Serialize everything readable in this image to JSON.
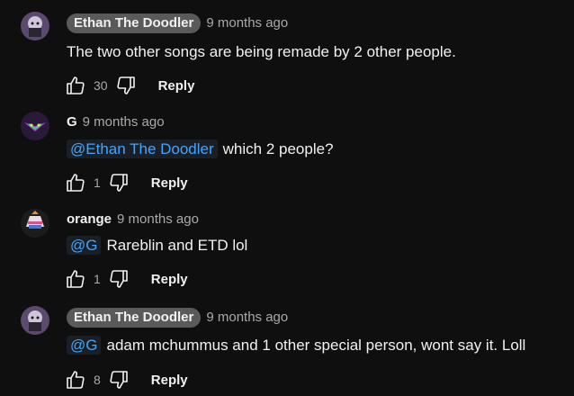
{
  "comments": [
    {
      "author": "Ethan The Doodler",
      "author_style": "pill",
      "time": "9 months ago",
      "mention": "",
      "text": "The two other songs are being remade by 2 other people.",
      "likes": "30",
      "reply_label": "Reply"
    },
    {
      "author": "G",
      "author_style": "plain",
      "time": "9 months ago",
      "mention": "@Ethan The Doodler",
      "text": "which 2 people?",
      "likes": "1",
      "reply_label": "Reply"
    },
    {
      "author": "orange",
      "author_style": "plain",
      "time": "9 months ago",
      "mention": "@G",
      "text": "Rareblin and ETD lol",
      "likes": "1",
      "reply_label": "Reply"
    },
    {
      "author": "Ethan The Doodler",
      "author_style": "pill",
      "time": "9 months ago",
      "mention": "@G",
      "text": "adam mchummus and 1 other special person, wont say it. Loll",
      "likes": "8",
      "reply_label": "Reply"
    }
  ],
  "colors": {
    "background": "#0f0f0f",
    "text": "#f1f1f1",
    "secondary": "#aaaaaa",
    "mention": "#3ea6ff",
    "author_pill": "#5a5a5a"
  }
}
